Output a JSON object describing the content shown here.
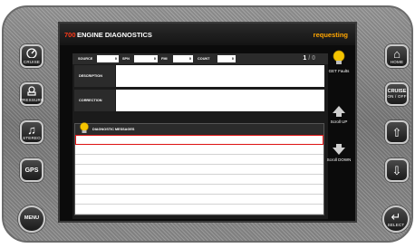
{
  "screen": {
    "title_number": "700",
    "title": "ENGINE DIAGNOSTICS",
    "status": "requesting"
  },
  "fields": {
    "source_label": "SOURCE",
    "source_value": "0",
    "spn_label": "SPN",
    "spn_value": "0",
    "fmi_label": "FMI",
    "fmi_value": "0",
    "count_label": "COUNT",
    "count_value": "0",
    "page_current": "1",
    "page_sep": "/",
    "page_total": "0"
  },
  "rows": {
    "description_label": "DESCRIPTION",
    "description_value": "",
    "correction_label": "CORRECTION",
    "correction_value": ""
  },
  "messages": {
    "header": "DIAGNOSTIC MESSAGES",
    "items": [
      "",
      "",
      "",
      "",
      "",
      "",
      "",
      ""
    ]
  },
  "side_buttons": {
    "get_faults": "GET Faults",
    "scroll_up": "Scroll UP",
    "scroll_down": "Scroll DOWN"
  },
  "hardware": {
    "cruise_label": "CRUISE",
    "tire_label": "PRESSURE",
    "stereo_label": "STEREO",
    "gps_label": "GPS",
    "menu_label": "MENU",
    "home_label": "HOME",
    "cruise_onoff_label": "CRUISE",
    "cruise_onoff_sub": "ON / OFF",
    "select_label": "SELECT"
  }
}
